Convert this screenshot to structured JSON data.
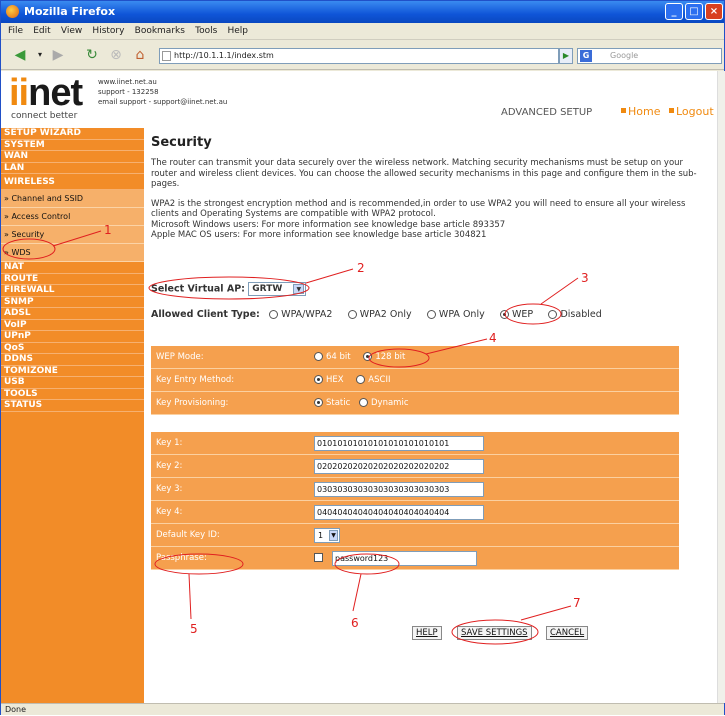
{
  "window": {
    "title": "Mozilla Firefox"
  },
  "menu": [
    "File",
    "Edit",
    "View",
    "History",
    "Bookmarks",
    "Tools",
    "Help"
  ],
  "address": {
    "url": "http://10.1.1.1/index.stm",
    "search_placeholder": "Google"
  },
  "status_text": "Done",
  "header": {
    "logo_ii": "ii",
    "logo_net": "net",
    "tagline": "connect better",
    "contact_line1": "www.iinet.net.au",
    "contact_line2": "support - 132258",
    "contact_line3": "email support - support@iinet.net.au",
    "section": "ADVANCED SETUP",
    "home": "Home",
    "logout": "Logout"
  },
  "sidebar": {
    "items_top": [
      "SETUP WIZARD",
      "SYSTEM",
      "WAN",
      "LAN",
      "WIRELESS"
    ],
    "subitems": [
      "» Channel and SSID",
      "» Access Control",
      "» Security",
      "» WDS"
    ],
    "items_bottom": [
      "NAT",
      "ROUTE",
      "FIREWALL",
      "SNMP",
      "ADSL",
      "VoIP",
      "UPnP",
      "QoS",
      "DDNS",
      "TOMIZONE",
      "USB",
      "TOOLS",
      "STATUS"
    ]
  },
  "main": {
    "title": "Security",
    "para1": "The router can transmit your data securely over the wireless network. Matching security mechanisms must be setup on your router and wireless client devices. You can choose the allowed security mechanisms in this page and configure them in the sub-pages.",
    "para2_l1": "WPA2 is the strongest encryption method and is recommended,in order to use WPA2 you will need to ensure all your wireless clients and Operating Systems are compatible with WPA2 protocol.",
    "para2_l2": "Microsoft Windows users: For more information see knowledge base article 893357",
    "para2_l3": "Apple MAC OS users: For more information see knowledge base article 304821",
    "vap_label": "Select Virtual AP:",
    "vap_value": "GRTW",
    "client_label": "Allowed Client Type:",
    "client_options": [
      "WPA/WPA2",
      "WPA2 Only",
      "WPA Only",
      "WEP",
      "Disabled"
    ],
    "wep": {
      "mode_label": "WEP Mode:",
      "mode_64": "64 bit",
      "mode_128": "128 bit",
      "entry_label": "Key Entry Method:",
      "entry_hex": "HEX",
      "entry_ascii": "ASCII",
      "prov_label": "Key Provisioning:",
      "prov_static": "Static",
      "prov_dynamic": "Dynamic"
    },
    "keys": {
      "key1_label": "Key 1:",
      "key1": "01010101010101010101010101",
      "key2_label": "Key 2:",
      "key2": "02020202020202020202020202",
      "key3_label": "Key 3:",
      "key3": "03030303030303030303030303",
      "key4_label": "Key 4:",
      "key4": "04040404040404040404040404",
      "default_label": "Default Key ID:",
      "default_value": "1",
      "pass_label": "Passphrase:",
      "pass_value": "password123"
    },
    "buttons": {
      "help": "HELP",
      "save": "SAVE SETTINGS",
      "cancel": "CANCEL"
    }
  },
  "annotations": [
    "1",
    "2",
    "3",
    "4",
    "5",
    "6",
    "7"
  ],
  "colors": {
    "sidebar": "#f28c28",
    "panel": "#f5a04e",
    "annotation": "#e02020",
    "brand": "#f08a10"
  }
}
